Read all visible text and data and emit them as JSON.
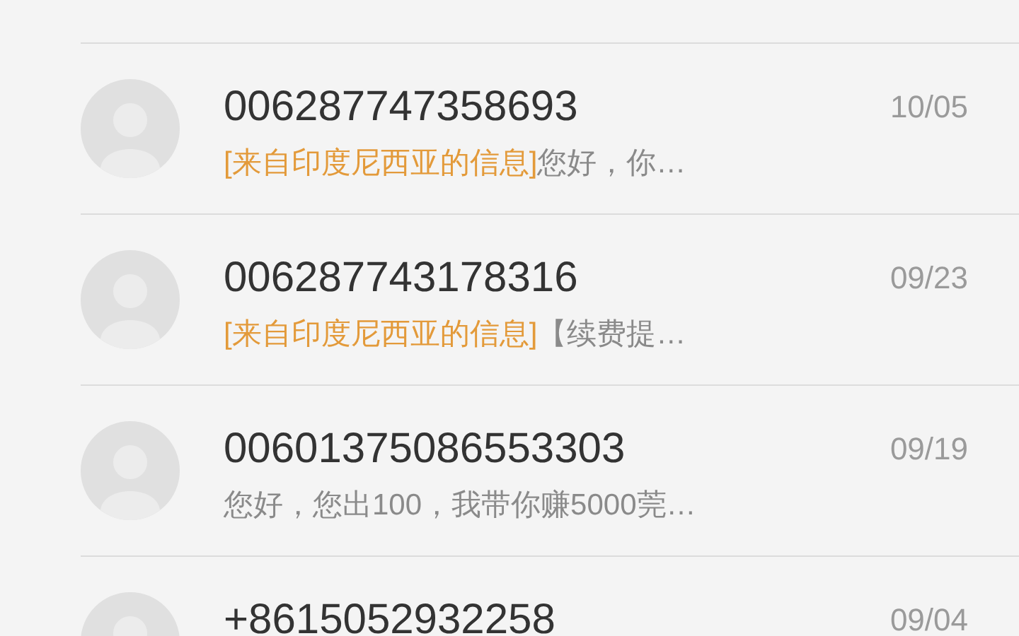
{
  "conversations": [
    {
      "sender": "006287747358693",
      "tag": "[来自印度尼西亚的信息]",
      "preview": "您好，你…",
      "date": "10/05"
    },
    {
      "sender": "006287743178316",
      "tag": "[来自印度尼西亚的信息]",
      "preview": "【续费提…",
      "date": "09/23"
    },
    {
      "sender": "00601375086553303",
      "preview": "您好，您出100，我带你赚5000莞…",
      "date": "09/19"
    },
    {
      "sender": "+8615052932258",
      "date": "09/04"
    }
  ]
}
